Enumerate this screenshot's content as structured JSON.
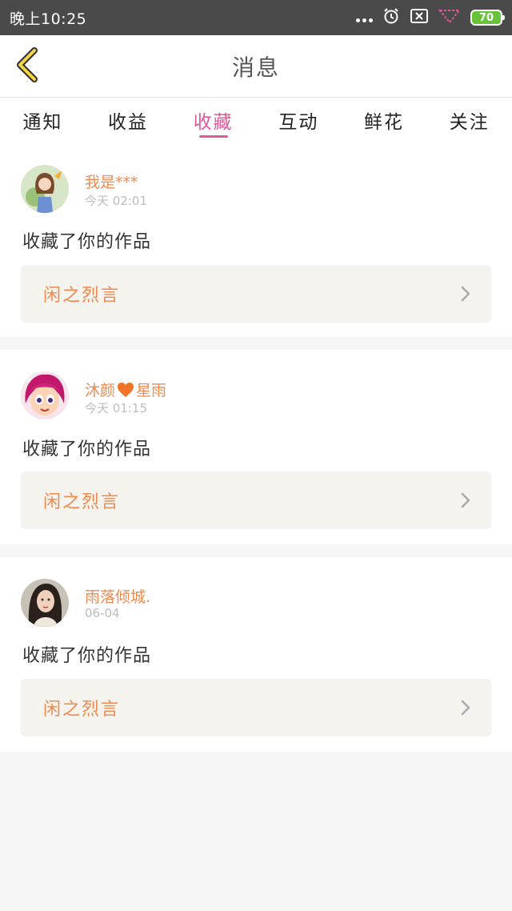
{
  "status_bar": {
    "time": "晚上10:25",
    "battery": "70",
    "icons": [
      "more-dots-icon",
      "alarm-icon",
      "sim-x-icon",
      "signal-icon",
      "battery-icon"
    ],
    "colors": {
      "bg": "#4a4a4a",
      "battery": "#68c23a"
    }
  },
  "navbar": {
    "title": "消息",
    "back_icon": "chevron-left-icon",
    "back_color": "#f2d64b"
  },
  "tabs": [
    {
      "label": "通知",
      "active": false
    },
    {
      "label": "收益",
      "active": false
    },
    {
      "label": "收藏",
      "active": true
    },
    {
      "label": "互动",
      "active": false
    },
    {
      "label": "鲜花",
      "active": false
    },
    {
      "label": "关注",
      "active": false
    }
  ],
  "accent_color": "#e0579a",
  "name_color": "#ee8a50",
  "items": [
    {
      "user_name": "我是***",
      "time": "今天 02:01",
      "action": "收藏了你的作品",
      "work_title": "闲之烈言",
      "avatar": "anime-girl-avatar"
    },
    {
      "user_name": "沐颜",
      "user_name_suffix": "星雨",
      "heart_icon": "heart-icon",
      "time": "今天 01:15",
      "action": "收藏了你的作品",
      "work_title": "闲之烈言",
      "avatar": "cartoon-girl-avatar"
    },
    {
      "user_name": "雨落倾城.",
      "time": "06-04",
      "action": "收藏了你的作品",
      "work_title": "闲之烈言",
      "avatar": "photo-woman-avatar"
    }
  ]
}
